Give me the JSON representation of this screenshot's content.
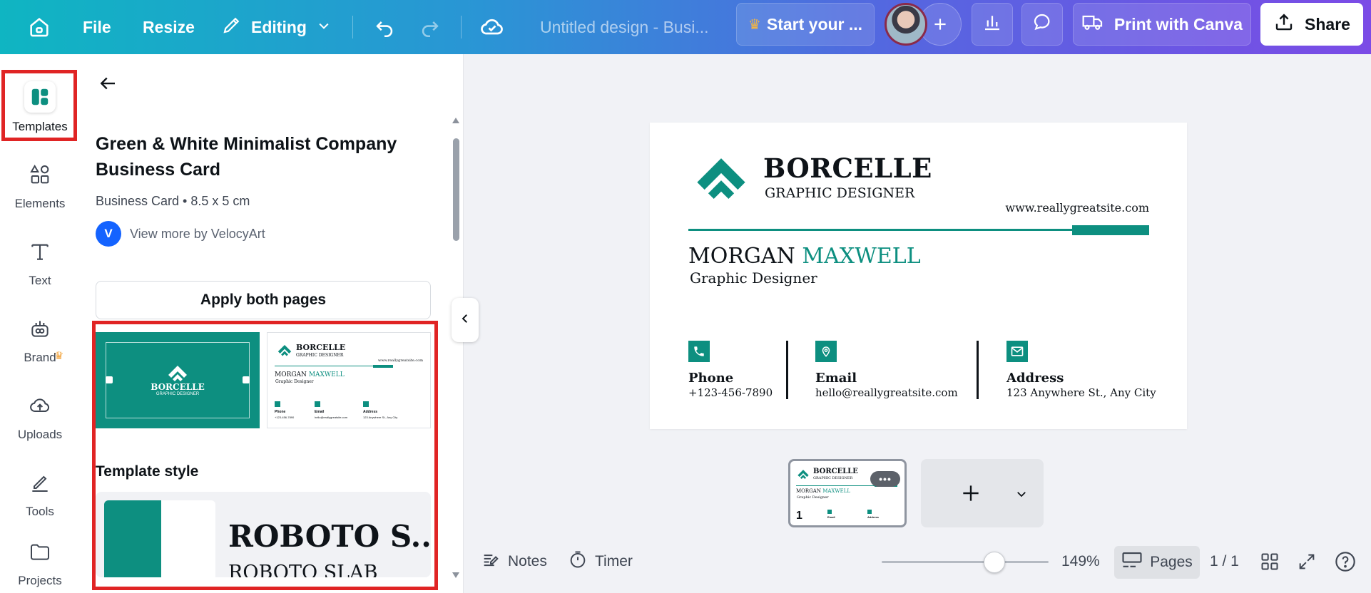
{
  "topbar": {
    "file_label": "File",
    "resize_label": "Resize",
    "editing_label": "Editing",
    "doc_title": "Untitled design - Busi...",
    "trial_label": "Start your ...",
    "print_label": "Print with Canva",
    "share_label": "Share"
  },
  "rail": {
    "items": [
      {
        "label": "Templates"
      },
      {
        "label": "Elements"
      },
      {
        "label": "Text"
      },
      {
        "label": "Brand"
      },
      {
        "label": "Uploads"
      },
      {
        "label": "Tools"
      },
      {
        "label": "Projects"
      }
    ]
  },
  "panel": {
    "title": "Green & White Minimalist Company Business Card",
    "meta": "Business Card • 8.5 x 5 cm",
    "author_initial": "V",
    "author_link": "View more by VelocyArt",
    "apply_label": "Apply both pages",
    "thumb_front": {
      "brand": "BORCELLE",
      "sub": "GRAPHIC DESIGNER"
    },
    "section_style": "Template style",
    "style_font_1": "ROBOTO S...",
    "style_font_2": "ROBOTO SLAB"
  },
  "card": {
    "brand": "BORCELLE",
    "subtitle": "GRAPHIC DESIGNER",
    "website": "www.reallygreatsite.com",
    "first_name": "MORGAN",
    "last_name": "MAXWELL",
    "job_title": "Graphic Designer",
    "contacts": [
      {
        "label": "Phone",
        "value": "+123-456-7890"
      },
      {
        "label": "Email",
        "value": "hello@reallygreatsite.com"
      },
      {
        "label": "Address",
        "value": "123 Anywhere St., Any City"
      }
    ],
    "accent": "#0d8f80"
  },
  "pages": {
    "current_page_number": "1",
    "more_label": "•••"
  },
  "bottombar": {
    "notes_label": "Notes",
    "timer_label": "Timer",
    "zoom_label": "149%",
    "pages_label": "Pages",
    "page_count": "1 / 1"
  }
}
